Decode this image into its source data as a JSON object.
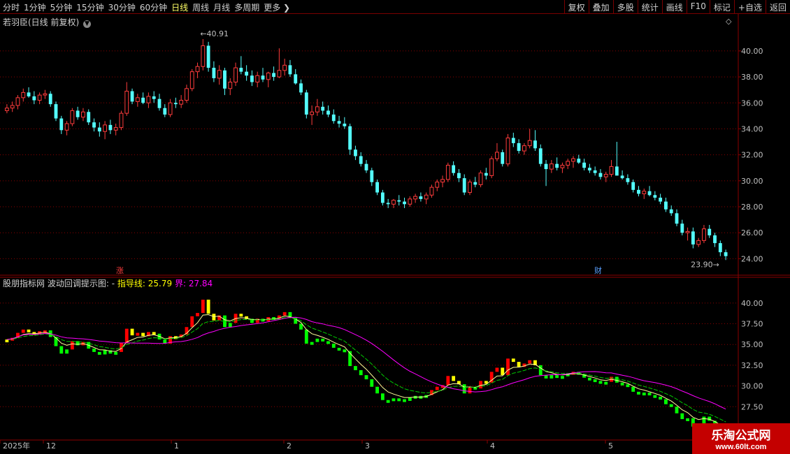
{
  "toolbar": {
    "periods": [
      "分时",
      "1分钟",
      "5分钟",
      "15分钟",
      "30分钟",
      "60分钟",
      "日线",
      "周线",
      "月线",
      "多周期",
      "更多"
    ],
    "active": "日线",
    "right_buttons": [
      "复权",
      "叠加",
      "多股",
      "统计",
      "画线",
      "F10",
      "标记",
      "+自选",
      "返回"
    ]
  },
  "main_panel": {
    "title": "若羽臣(日线 前复权)",
    "high_label": "40.91",
    "low_label": "23.90",
    "marker_zhang": "涨",
    "marker_cai": "财",
    "y_ticks": [
      "40.00",
      "38.00",
      "36.00",
      "34.00",
      "32.00",
      "30.00",
      "28.00",
      "26.00",
      "24.00"
    ]
  },
  "indicator_panel": {
    "name": "股朋指标网",
    "formula": "波动回调提示图: -",
    "guide_label": "指导线:",
    "guide_value": "25.79",
    "bound_label": "界:",
    "bound_value": "27.84",
    "y_ticks": [
      "40.00",
      "37.50",
      "35.00",
      "32.50",
      "30.00",
      "27.50"
    ]
  },
  "x_axis": {
    "labels": [
      "2025年",
      "12",
      "1",
      "2",
      "3",
      "4",
      "5"
    ]
  },
  "watermark": {
    "line1": "乐淘公式网",
    "line2": "www.60lt.com"
  },
  "colors": {
    "up": "#ff3c3c",
    "down": "#54ffff",
    "bg": "#000000",
    "grid": "#8b0000",
    "axis": "#c0c0c0",
    "yellow": "#ffff00",
    "green": "#00ff00",
    "red": "#ff0000",
    "magenta": "#ff00ff"
  },
  "chart_data": [
    {
      "type": "candlestick",
      "title": "若羽臣(日线 前复权)",
      "ylim": [
        23,
        41.5
      ],
      "annotations": {
        "high": 40.91,
        "low": 23.9
      },
      "series": [
        {
          "name": "",
          "ohlc": [
            [
              35.4,
              35.9,
              35.2,
              35.6
            ],
            [
              35.6,
              36.1,
              35.3,
              35.8
            ],
            [
              35.8,
              36.6,
              35.5,
              36.4
            ],
            [
              36.4,
              37.1,
              36.1,
              36.8
            ],
            [
              36.8,
              37.2,
              36.4,
              36.5
            ],
            [
              36.5,
              36.9,
              35.9,
              36.2
            ],
            [
              36.2,
              36.8,
              35.9,
              36.6
            ],
            [
              36.6,
              37.0,
              36.3,
              36.7
            ],
            [
              36.7,
              36.9,
              35.7,
              35.9
            ],
            [
              35.9,
              36.1,
              34.6,
              34.8
            ],
            [
              34.8,
              35.0,
              33.6,
              33.9
            ],
            [
              33.9,
              34.6,
              33.5,
              34.4
            ],
            [
              34.4,
              35.6,
              34.2,
              35.4
            ],
            [
              35.4,
              35.7,
              34.7,
              34.9
            ],
            [
              34.9,
              35.6,
              34.6,
              35.3
            ],
            [
              35.3,
              35.5,
              34.3,
              34.5
            ],
            [
              34.5,
              34.8,
              33.8,
              34.1
            ],
            [
              34.1,
              34.5,
              33.4,
              33.8
            ],
            [
              33.8,
              34.6,
              33.2,
              34.3
            ],
            [
              34.3,
              34.7,
              33.6,
              33.9
            ],
            [
              33.9,
              34.4,
              33.5,
              34.1
            ],
            [
              34.1,
              35.4,
              33.9,
              35.2
            ],
            [
              35.2,
              37.6,
              35.0,
              36.9
            ],
            [
              36.9,
              37.1,
              35.9,
              36.1
            ],
            [
              36.1,
              36.7,
              35.7,
              36.4
            ],
            [
              36.4,
              36.8,
              35.9,
              36.0
            ],
            [
              36.0,
              36.8,
              35.6,
              36.5
            ],
            [
              36.5,
              36.9,
              36.0,
              36.3
            ],
            [
              36.3,
              36.7,
              35.4,
              35.6
            ],
            [
              35.6,
              35.9,
              34.9,
              35.1
            ],
            [
              35.1,
              36.3,
              34.9,
              36.0
            ],
            [
              36.0,
              36.4,
              35.6,
              35.9
            ],
            [
              35.9,
              36.6,
              35.6,
              36.2
            ],
            [
              36.2,
              37.4,
              36.0,
              37.1
            ],
            [
              37.1,
              38.6,
              36.9,
              38.4
            ],
            [
              38.4,
              39.1,
              37.9,
              38.8
            ],
            [
              38.8,
              40.91,
              38.5,
              40.4
            ],
            [
              40.4,
              40.7,
              38.4,
              38.7
            ],
            [
              38.7,
              39.2,
              37.6,
              37.9
            ],
            [
              37.9,
              38.9,
              37.4,
              38.5
            ],
            [
              38.5,
              38.7,
              36.6,
              37.1
            ],
            [
              37.1,
              37.9,
              36.6,
              37.6
            ],
            [
              37.6,
              39.1,
              37.3,
              38.7
            ],
            [
              38.7,
              39.6,
              38.2,
              38.4
            ],
            [
              38.4,
              38.9,
              37.7,
              38.1
            ],
            [
              38.1,
              38.5,
              37.3,
              37.6
            ],
            [
              37.6,
              38.4,
              37.2,
              38.1
            ],
            [
              38.1,
              38.7,
              37.6,
              37.8
            ],
            [
              37.8,
              38.4,
              37.2,
              38.3
            ],
            [
              38.3,
              38.8,
              37.7,
              38.0
            ],
            [
              38.0,
              40.2,
              37.9,
              38.5
            ],
            [
              38.5,
              39.4,
              38.1,
              38.9
            ],
            [
              38.9,
              39.3,
              38.0,
              38.2
            ],
            [
              38.2,
              38.6,
              37.4,
              37.5
            ],
            [
              37.5,
              37.8,
              36.6,
              36.8
            ],
            [
              36.8,
              37.0,
              34.8,
              35.1
            ],
            [
              35.1,
              35.8,
              34.3,
              35.3
            ],
            [
              35.3,
              36.3,
              35.0,
              35.7
            ],
            [
              35.7,
              36.1,
              35.1,
              35.4
            ],
            [
              35.4,
              35.8,
              34.9,
              35.1
            ],
            [
              35.1,
              35.5,
              34.4,
              34.6
            ],
            [
              34.6,
              35.0,
              34.1,
              34.4
            ],
            [
              34.4,
              34.9,
              34.0,
              34.2
            ],
            [
              34.2,
              34.4,
              32.0,
              32.4
            ],
            [
              32.4,
              32.7,
              31.6,
              31.9
            ],
            [
              31.9,
              32.2,
              31.1,
              31.3
            ],
            [
              31.3,
              31.6,
              30.6,
              30.8
            ],
            [
              30.8,
              31.0,
              29.6,
              29.9
            ],
            [
              29.9,
              30.1,
              28.9,
              29.1
            ],
            [
              29.1,
              29.3,
              28.1,
              28.3
            ],
            [
              28.3,
              28.6,
              27.9,
              28.2
            ],
            [
              28.2,
              28.6,
              27.9,
              28.5
            ],
            [
              28.5,
              28.9,
              28.1,
              28.4
            ],
            [
              28.4,
              28.7,
              27.9,
              28.2
            ],
            [
              28.2,
              28.8,
              28.0,
              28.6
            ],
            [
              28.6,
              29.0,
              28.3,
              28.8
            ],
            [
              28.8,
              29.1,
              28.4,
              28.6
            ],
            [
              28.6,
              29.1,
              28.2,
              28.9
            ],
            [
              28.9,
              29.7,
              28.7,
              29.5
            ],
            [
              29.5,
              30.1,
              29.2,
              29.9
            ],
            [
              29.9,
              30.4,
              29.5,
              30.1
            ],
            [
              30.1,
              31.4,
              29.9,
              31.2
            ],
            [
              31.2,
              31.5,
              30.4,
              30.6
            ],
            [
              30.6,
              30.9,
              29.9,
              30.2
            ],
            [
              30.2,
              30.5,
              28.9,
              29.1
            ],
            [
              29.1,
              30.1,
              28.9,
              29.9
            ],
            [
              29.9,
              30.3,
              29.5,
              29.7
            ],
            [
              29.7,
              30.8,
              29.5,
              30.6
            ],
            [
              30.6,
              31.0,
              30.1,
              30.4
            ],
            [
              30.4,
              31.9,
              30.2,
              31.7
            ],
            [
              31.7,
              32.9,
              31.5,
              32.2
            ],
            [
              32.2,
              32.4,
              31.1,
              31.3
            ],
            [
              31.3,
              33.6,
              31.1,
              33.3
            ],
            [
              33.3,
              33.7,
              32.6,
              32.9
            ],
            [
              32.9,
              33.2,
              32.1,
              32.3
            ],
            [
              32.3,
              32.9,
              32.0,
              32.7
            ],
            [
              32.7,
              34.0,
              32.5,
              33.1
            ],
            [
              33.1,
              33.9,
              32.3,
              32.5
            ],
            [
              32.5,
              32.8,
              31.1,
              31.3
            ],
            [
              31.3,
              31.6,
              29.6,
              30.9
            ],
            [
              30.9,
              31.6,
              30.6,
              31.3
            ],
            [
              31.3,
              31.8,
              30.8,
              31.0
            ],
            [
              31.0,
              31.4,
              30.6,
              31.2
            ],
            [
              31.2,
              31.7,
              30.9,
              31.5
            ],
            [
              31.5,
              31.9,
              31.0,
              31.7
            ],
            [
              31.7,
              32.0,
              31.3,
              31.4
            ],
            [
              31.4,
              31.7,
              30.8,
              31.0
            ],
            [
              31.0,
              31.3,
              30.6,
              30.8
            ],
            [
              30.8,
              31.1,
              30.4,
              30.6
            ],
            [
              30.6,
              30.9,
              30.1,
              30.3
            ],
            [
              30.3,
              30.7,
              29.9,
              30.5
            ],
            [
              30.5,
              31.6,
              30.3,
              31.1
            ],
            [
              31.1,
              33.0,
              30.9,
              30.4
            ],
            [
              30.4,
              30.8,
              30.1,
              30.2
            ],
            [
              30.2,
              30.5,
              29.7,
              29.9
            ],
            [
              29.9,
              30.1,
              29.1,
              29.3
            ],
            [
              29.3,
              29.6,
              28.8,
              29.0
            ],
            [
              29.0,
              29.4,
              28.6,
              29.2
            ],
            [
              29.2,
              29.6,
              28.8,
              28.9
            ],
            [
              28.9,
              29.2,
              28.5,
              28.7
            ],
            [
              28.7,
              29.0,
              28.2,
              28.4
            ],
            [
              28.4,
              28.7,
              27.6,
              27.8
            ],
            [
              27.8,
              28.1,
              27.3,
              27.5
            ],
            [
              27.5,
              27.8,
              26.5,
              26.7
            ],
            [
              26.7,
              27.0,
              25.8,
              26.0
            ],
            [
              26.0,
              26.4,
              25.4,
              26.1
            ],
            [
              26.1,
              26.4,
              24.8,
              25.1
            ],
            [
              25.1,
              25.6,
              24.9,
              25.4
            ],
            [
              25.4,
              26.6,
              25.2,
              26.3
            ],
            [
              26.3,
              26.6,
              25.6,
              25.8
            ],
            [
              25.8,
              26.0,
              24.9,
              25.2
            ],
            [
              25.2,
              25.4,
              24.2,
              24.5
            ],
            [
              24.5,
              24.7,
              23.9,
              24.2
            ]
          ]
        }
      ]
    },
    {
      "type": "bar",
      "title": "波动回调提示图",
      "ylim": [
        25.5,
        41.5
      ],
      "series": [
        {
          "name": "指导线",
          "value": 25.79
        },
        {
          "name": "界",
          "value": 27.84
        }
      ]
    }
  ]
}
